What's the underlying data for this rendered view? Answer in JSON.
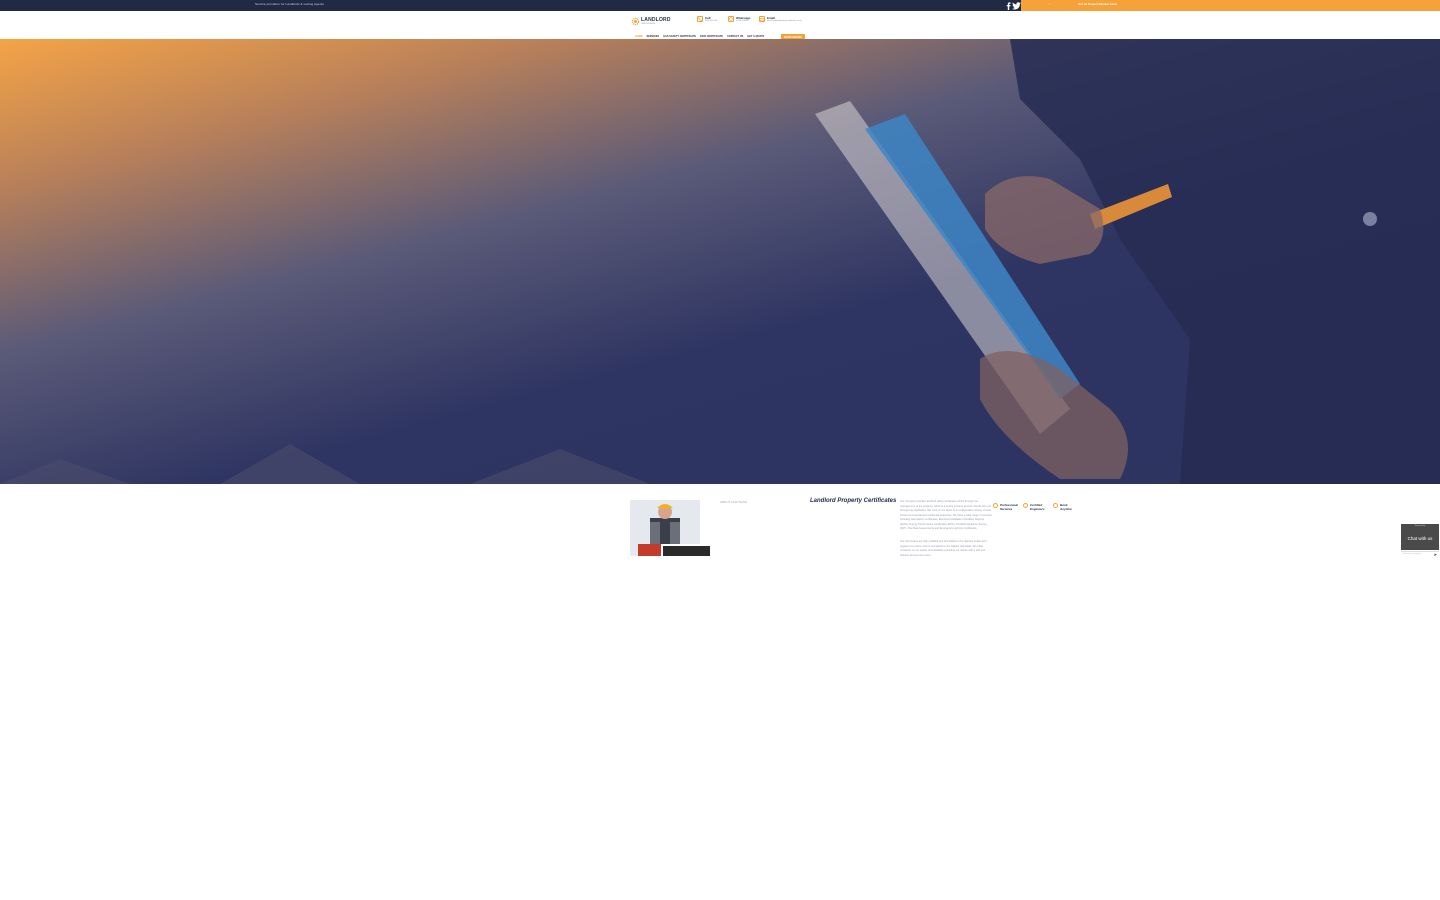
{
  "topbar": {
    "tagline": "Service providers for Landlords & Letting Agents",
    "cta": "Get an Expert Advisor Here",
    "arrow": "›"
  },
  "header": {
    "logo_text": "LANDLORD",
    "logo_sub": "CERTIFICATES",
    "contacts": [
      {
        "label": "Call",
        "value": "0800 000 000"
      },
      {
        "label": "Whatsapp",
        "value": "07000 000000"
      },
      {
        "label": "Email",
        "value": "info@landlordpropertycertificates.co.uk"
      }
    ],
    "nav": [
      "HOME",
      "SERVICES",
      "GAS SAFETY CERTIFICATE",
      "EICR CERTIFICATE",
      "CONTACT US",
      "GET A QUOTE"
    ],
    "book_label": "BOOK ONLINE"
  },
  "content": {
    "small_label": "ABOUT OUR TEAM",
    "title": "Landlord Property Certificates",
    "paragraph1": "Our company provides landlord safety certificates which through the management of the property, which is a tenant ensures all work checks are met through key legislation. We work on the basis of an independent variety of tests across commercial and residential properties. We have a wide range of services including Gas Safety Certificates, Electrical Installation Condition Reports (EICR), Energy Performance Certificates (EPC), Portable Appliance Testing (PAT), Fire Risk Assessments and Emergency Lighting Certificates.",
    "paragraph2": "Our technicians are fully qualified and accredited to the relevant bodies and registers to ensure work is completed to the highest standards. We pride ourselves on our quality and reliability, providing our clients with a fast and efficient service every time.",
    "features": [
      {
        "label": "Professional Services"
      },
      {
        "label": "Certified Engineers"
      },
      {
        "label": "Book Anytime"
      }
    ]
  },
  "chat": {
    "top": "Powered by",
    "label": "Chat with us",
    "placeholder": "Enter your message...",
    "send_icon": "➤"
  },
  "colors": {
    "accent": "#f6a23a",
    "navy": "#1f2a44"
  }
}
